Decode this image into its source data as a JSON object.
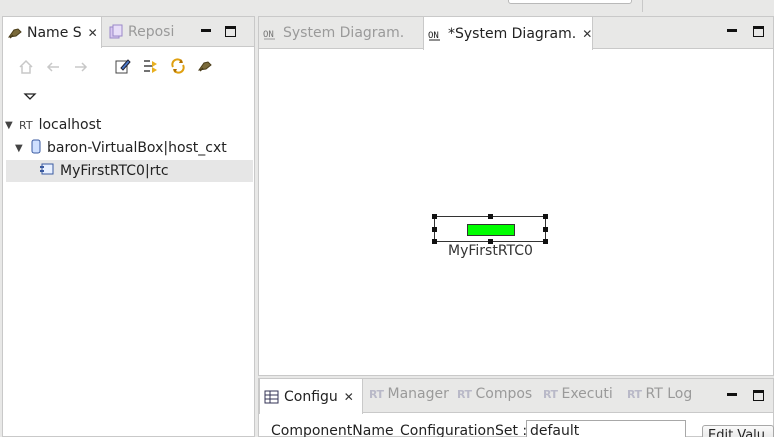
{
  "left_panel": {
    "tabs": [
      {
        "label": "Name S",
        "active": true
      },
      {
        "label": "Reposi",
        "active": false
      }
    ],
    "toolbar_icons": [
      "home-icon",
      "back-icon",
      "forward-icon",
      "edit-icon",
      "filter-icon",
      "refresh-icon",
      "connect-icon"
    ],
    "view_menu_icon": "chevron-down-icon",
    "tree": [
      {
        "label": "localhost",
        "level": 0,
        "expanded": true
      },
      {
        "label": "baron-VirtualBox|host_cxt",
        "level": 1,
        "expanded": true
      },
      {
        "label": "MyFirstRTC0|rtc",
        "level": 2,
        "selected": true
      }
    ]
  },
  "editor": {
    "tabs": [
      {
        "label": "System Diagram.",
        "active": false
      },
      {
        "label": "*System Diagram.",
        "active": true
      }
    ],
    "component": {
      "label": "MyFirstRTC0",
      "color": "#00ff00"
    }
  },
  "bottom_panel": {
    "tabs": [
      {
        "label": "Configu",
        "active": true
      },
      {
        "label": "Manager",
        "active": false
      },
      {
        "label": "Compos",
        "active": false
      },
      {
        "label": "Executi",
        "active": false
      },
      {
        "label": "RT Log",
        "active": false
      }
    ],
    "rt_icon_text": "RT",
    "columns": {
      "component_name": "ComponentName",
      "configuration_set": "ConfigurationSet :"
    },
    "configuration_set_value": "default",
    "edit_button_label": "Edit Valu"
  }
}
